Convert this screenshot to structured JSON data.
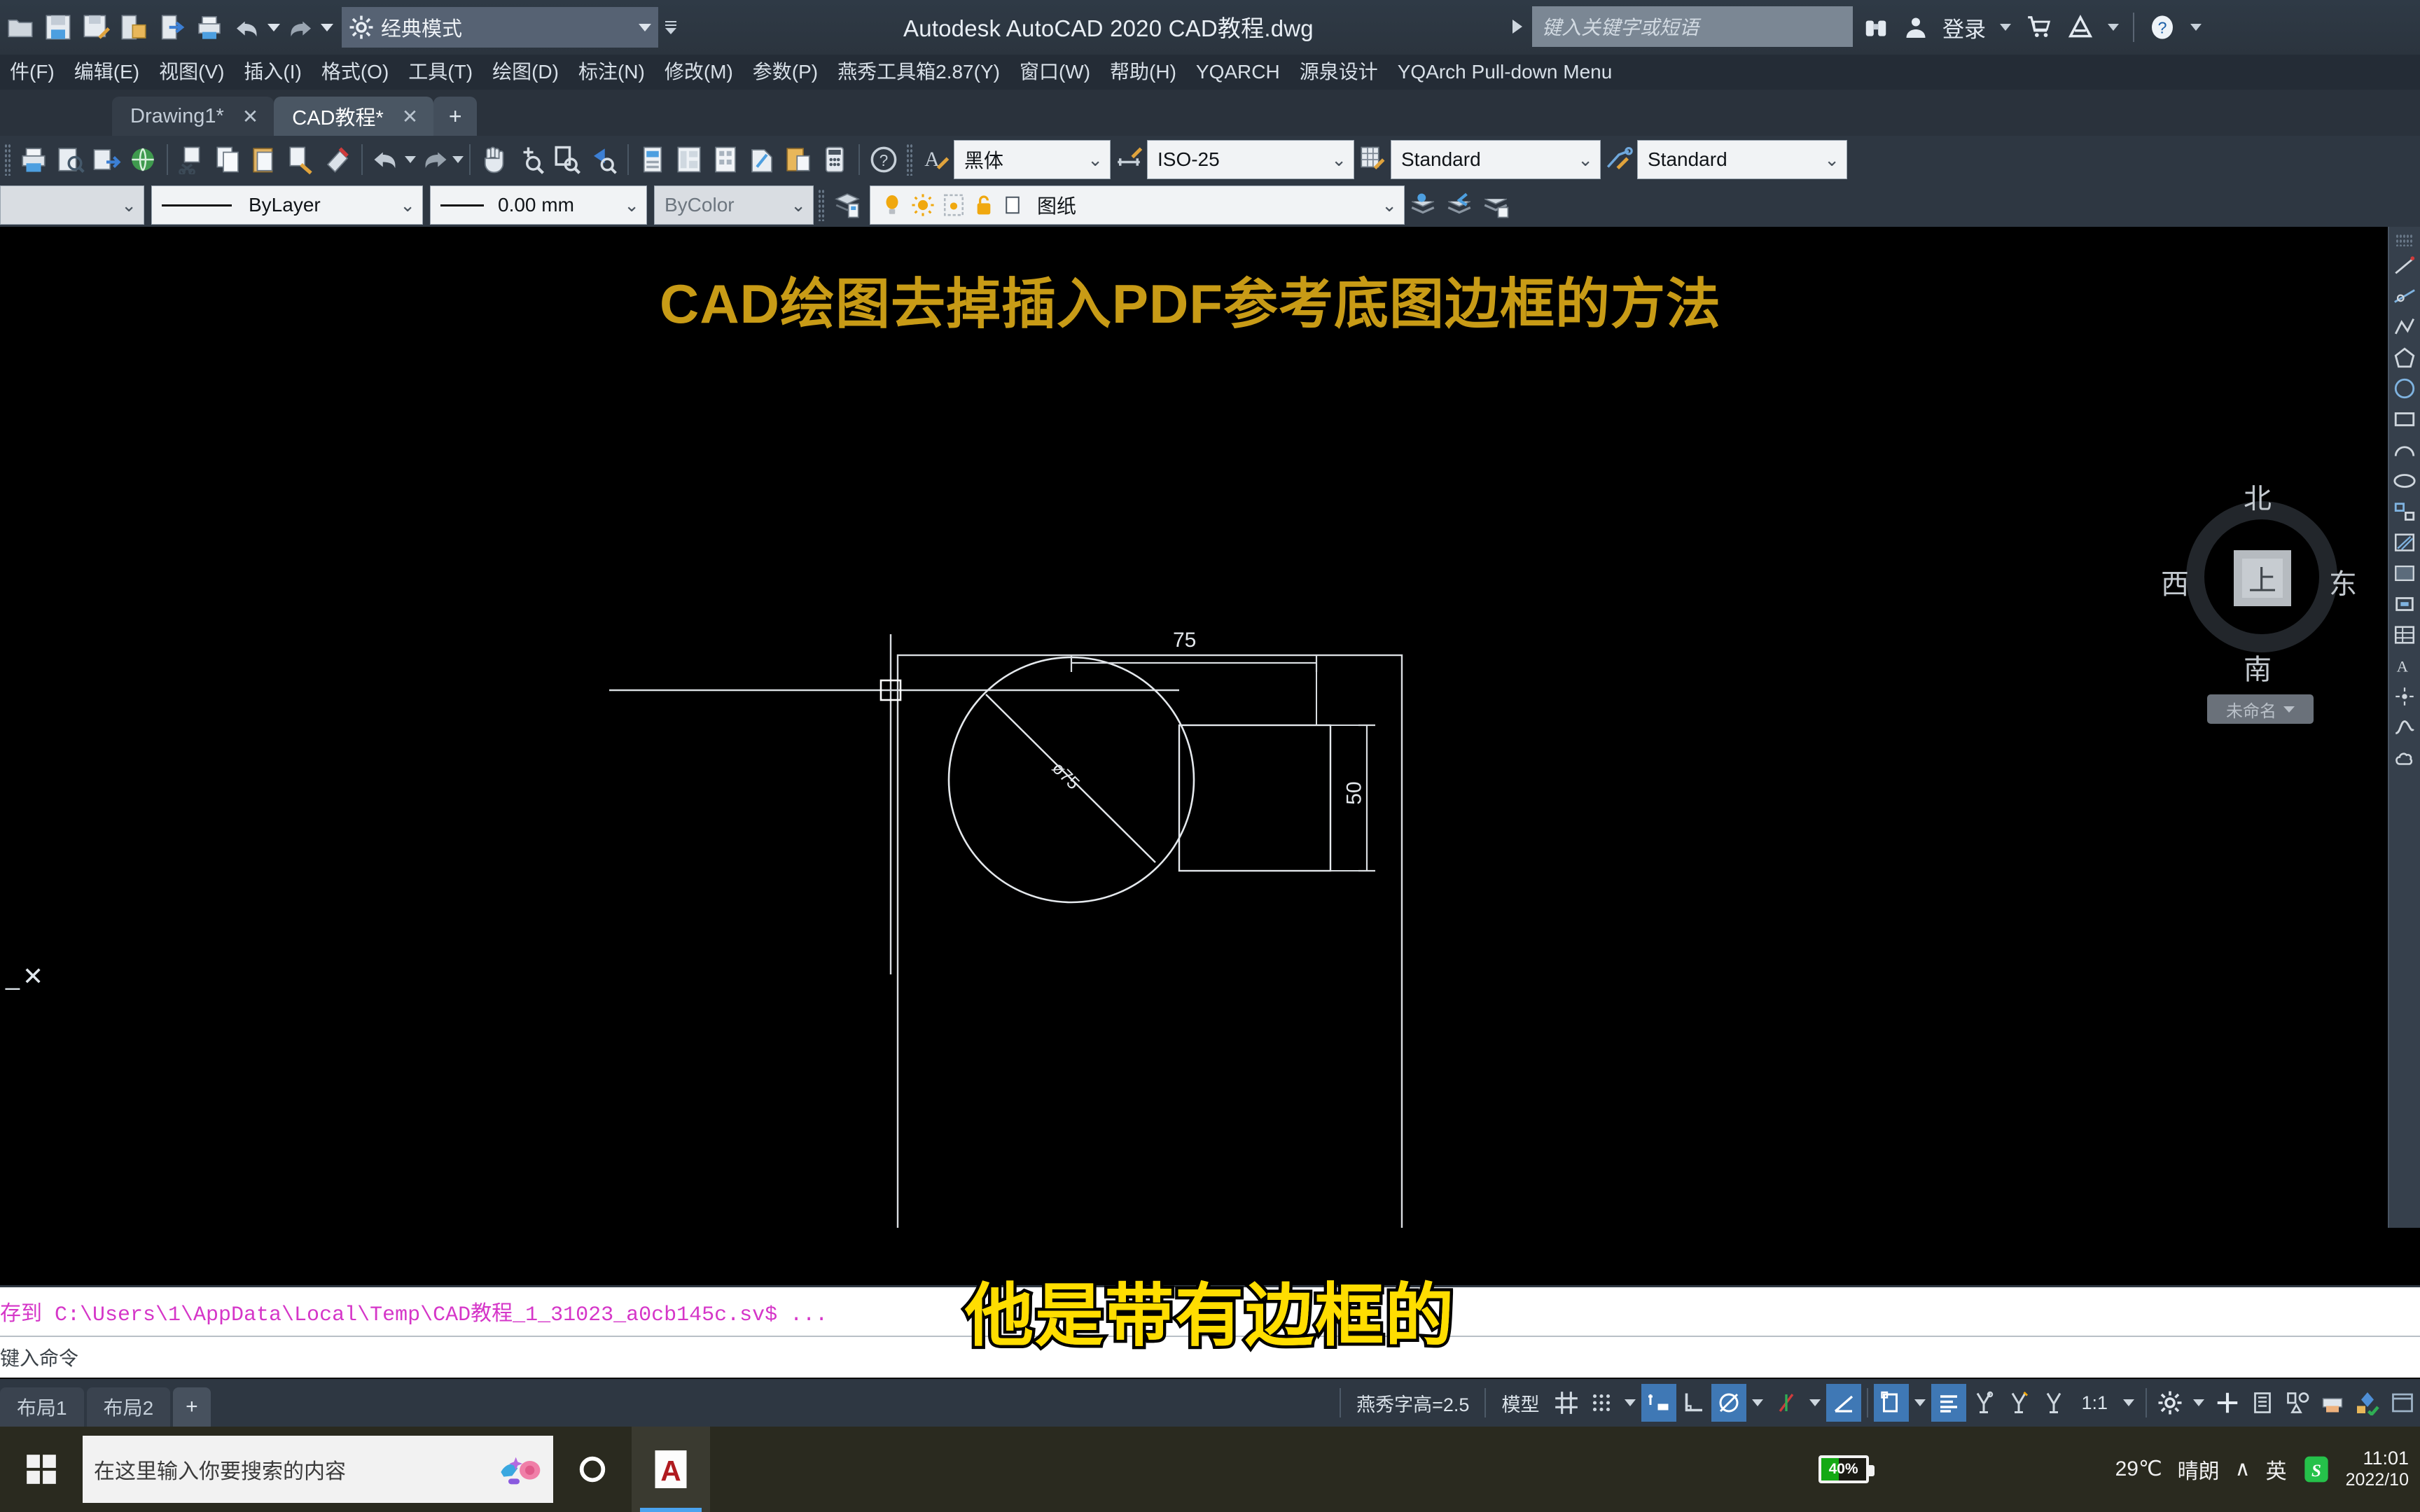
{
  "titlebar": {
    "workspace": "经典模式",
    "app_title": "Autodesk AutoCAD 2020   CAD教程.dwg",
    "search_placeholder": "键入关键字或短语",
    "signin_label": "登录",
    "qat_icons": [
      "open-icon",
      "save-icon",
      "saveas-icon",
      "export-icon",
      "publish-icon",
      "plot-icon",
      "undo-icon",
      "redo-icon"
    ],
    "right_icons": [
      "binoculars-icon",
      "user-icon",
      "cart-icon",
      "autodesk-icon",
      "help-icon"
    ]
  },
  "menubar": {
    "items": [
      "件(F)",
      "编辑(E)",
      "视图(V)",
      "插入(I)",
      "格式(O)",
      "工具(T)",
      "绘图(D)",
      "标注(N)",
      "修改(M)",
      "参数(P)",
      "燕秀工具箱2.87(Y)",
      "窗口(W)",
      "帮助(H)",
      "YQARCH",
      "源泉设计",
      "YQArch Pull-down Menu"
    ]
  },
  "doctabs": {
    "tabs": [
      {
        "label": "Drawing1*",
        "active": false,
        "close": "✕"
      },
      {
        "label": "CAD教程*",
        "active": true,
        "close": "✕"
      }
    ],
    "new_tab": "+"
  },
  "toolbar_row1": {
    "dropdowns": [
      {
        "name": "text-style",
        "value": "黑体"
      },
      {
        "name": "dim-style",
        "value": "ISO-25"
      },
      {
        "name": "table-style",
        "value": "Standard"
      },
      {
        "name": "mleader-style",
        "value": "Standard"
      }
    ],
    "icons": [
      "print-icon",
      "plot-preview-icon",
      "plot-publish-icon",
      "web-icon",
      "cut-icon",
      "copy-icon",
      "paste-icon",
      "matchprop-icon",
      "erase-icon",
      "undo-icon",
      "redo-icon",
      "pan-icon",
      "zoom-icon",
      "zoom-window-icon",
      "zoom-previous-icon",
      "properties-icon",
      "designcenter-icon",
      "toolpalette-icon",
      "sheetset-icon",
      "markup-icon",
      "calculator-icon",
      "help-icon",
      "textstyle-icon"
    ]
  },
  "toolbar_row2": {
    "color_value": "",
    "linetype_value": "ByLayer",
    "lineweight_value": "0.00 mm",
    "plotstyle_value": "ByColor",
    "layer_value": "图纸",
    "layer_icons": [
      "lightbulb-icon",
      "sun-icon",
      "freeze-icon",
      "unlock-icon",
      "color-swatch-icon"
    ],
    "layer_tools": [
      "layer-properties-icon",
      "layer-previous-icon",
      "layer-state-icon",
      "layer-match-icon"
    ]
  },
  "canvas": {
    "drawing_title": "CAD绘图去掉插入PDF参考底图边框的方法",
    "dim_width": "75",
    "dim_height": "50",
    "dim_diameter": "ø75",
    "compass": {
      "north": "北",
      "south": "南",
      "west": "西",
      "east": "东",
      "top_face": "上",
      "named_view": "未命名"
    },
    "close_glyph": "_✕"
  },
  "command_line": {
    "history": "存到 C:\\Users\\1\\AppData\\Local\\Temp\\CAD教程_1_31023_a0cb145c.sv$ ...",
    "prompt_placeholder": "键入命令"
  },
  "subtitle": {
    "text": "他是带有边框的"
  },
  "statusbar": {
    "layout_tabs": [
      "布局1",
      "布局2"
    ],
    "add_layout": "+",
    "text_height": "燕秀字高=2.5",
    "model_label": "模型",
    "scale": "1:1",
    "icons": [
      "grid-icon",
      "snap-icon",
      "infer-constraints-icon",
      "ortho-icon",
      "polar-icon",
      "osnap-icon",
      "otrack-icon",
      "lineweight-icon",
      "transparency-icon",
      "selection-cycling-icon",
      "annotation-visibility-icon",
      "annotation-scale-icon",
      "workspace-gear-icon",
      "customize-icon",
      "hardware-accel-icon",
      "isolate-icon",
      "clean-screen-icon"
    ]
  },
  "taskbar": {
    "search_placeholder": "在这里输入你要搜索的内容",
    "apps": [
      "cortana-icon",
      "autocad-icon"
    ],
    "battery_pct": "40%",
    "weather_temp": "29℃",
    "weather_desc": "晴朗",
    "ime_label": "英",
    "tray_chevron": "∧",
    "sogou_icon": "sogou-icon",
    "time": "11:01",
    "date": "2022/10"
  }
}
